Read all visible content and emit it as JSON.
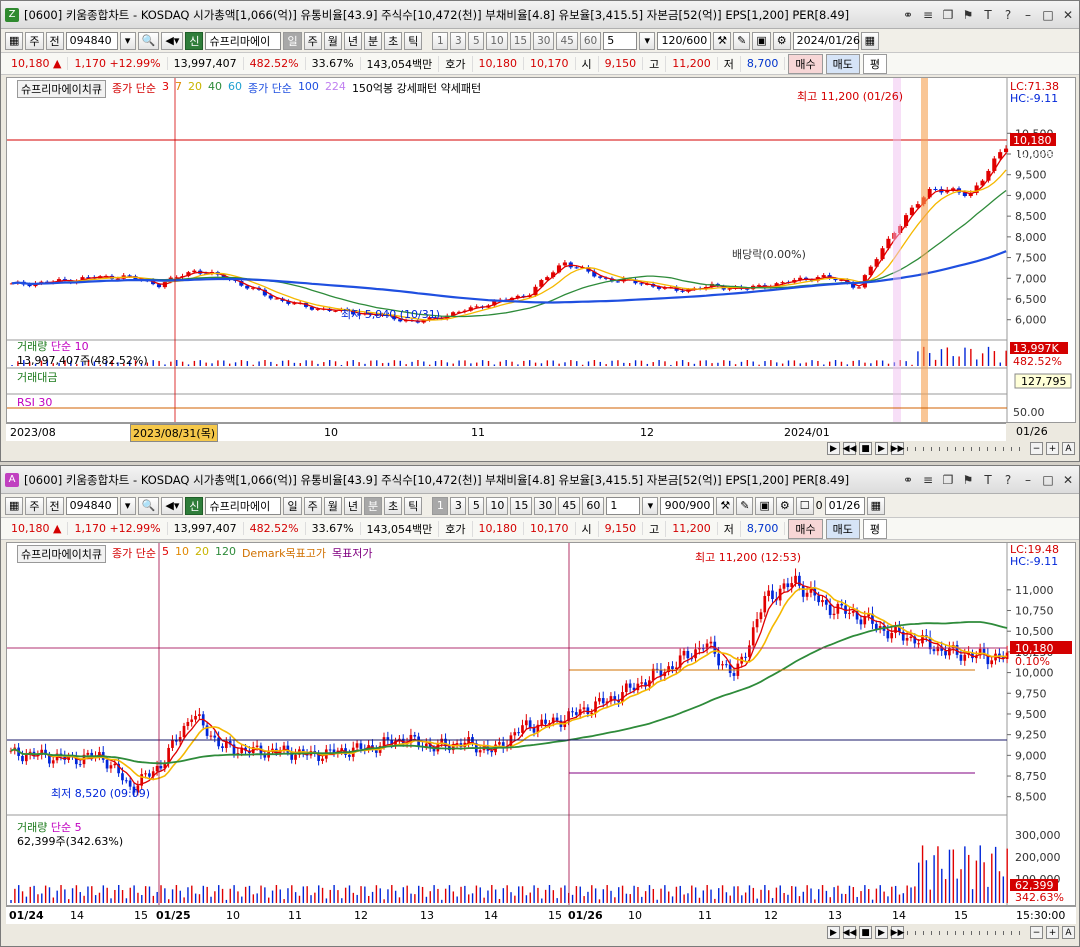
{
  "window_a": {
    "badge": "Z",
    "title": "[0600] 키움종합차트 - KOSDAQ 시가총액[1,066(억)] 유통비율[43.9] 주식수[10,472(천)] 부채비율[4.8] 유보율[3,415.5] 자본금[52(억)] EPS[1,200] PER[8.49]",
    "toolbar": {
      "period": "주",
      "prev": "전",
      "code": "094840",
      "stock_name": "슈프리마에이",
      "intervals": [
        "일",
        "주",
        "월",
        "년",
        "분",
        "초",
        "틱"
      ],
      "active_interval": "일",
      "numbers": [
        "1",
        "3",
        "5",
        "10",
        "15",
        "30",
        "45",
        "60"
      ],
      "unit": "5",
      "count": "120/600",
      "date": "2024/01/26"
    },
    "quote": {
      "price": "10,180",
      "change": "1,170",
      "change_pct": "+12.99%",
      "volume": "13,997,407",
      "volume_pct": "482.52%",
      "turnover": "33.67%",
      "amount": "143,054백만",
      "ask_label": "호가",
      "ask1": "10,180",
      "ask2": "10,170",
      "open_label": "시",
      "open": "9,150",
      "high_label": "고",
      "high": "11,200",
      "low_label": "저",
      "low": "8,700",
      "buy": "매수",
      "sell": "매도",
      "avg": "평"
    },
    "legend": {
      "name": "슈프리마에이치큐",
      "ma_label": "종가 단순",
      "ma_periods": [
        "3",
        "7",
        "20",
        "40",
        "60"
      ],
      "ma2_label": "종가 단순",
      "ma2_periods": [
        "100",
        "224"
      ],
      "extra": "150억봉 강세패턴 약세패턴"
    },
    "annotations": {
      "high": "최고 11,200 (01/26)",
      "low": "최저 5,940 (10/31)",
      "dividend": "배당락(0.00%)"
    },
    "price_axis": [
      "10,500",
      "10,000",
      "9,500",
      "9,000",
      "8,500",
      "8,000",
      "7,500",
      "7,000",
      "6,500",
      "6,000"
    ],
    "price_labels": {
      "lc": "LC:71.38",
      "hc": "HC:-9.11",
      "current": "10,180",
      "pct": "12.99%"
    },
    "volume": {
      "label": "거래량",
      "ma": "단순 10",
      "value": "13,997,407주(482.52%)",
      "badge": "13,997K",
      "pct": "482.52%"
    },
    "big_trade": {
      "label": "거래대금",
      "value": "127,795"
    },
    "rsi": {
      "label": "RSI 30",
      "axis": "50.00"
    },
    "x_axis": [
      "2023/08",
      "2023/08/31(목)",
      "10",
      "11",
      "12",
      "2024/01",
      "01/26"
    ]
  },
  "window_b": {
    "badge": "A",
    "title": "[0600] 키움종합차트 - KOSDAQ 시가총액[1,066(억)] 유통비율[43.9] 주식수[10,472(천)] 부채비율[4.8] 유보율[3,415.5] 자본금[52(억)] EPS[1,200] PER[8.49]",
    "toolbar": {
      "period": "주",
      "prev": "전",
      "code": "094840",
      "stock_name": "슈프리마에이",
      "intervals": [
        "일",
        "주",
        "월",
        "년",
        "분",
        "초",
        "틱"
      ],
      "active_interval": "분",
      "numbers": [
        "1",
        "3",
        "5",
        "10",
        "15",
        "30",
        "45",
        "60"
      ],
      "unit": "1",
      "count": "900/900",
      "check_label": "0",
      "date": "01/26"
    },
    "quote": {
      "price": "10,180",
      "change": "1,170",
      "change_pct": "+12.99%",
      "volume": "13,997,407",
      "volume_pct": "482.52%",
      "turnover": "33.67%",
      "amount": "143,054백만",
      "ask_label": "호가",
      "ask1": "10,180",
      "ask2": "10,170",
      "open_label": "시",
      "open": "9,150",
      "high_label": "고",
      "high": "11,200",
      "low_label": "저",
      "low": "8,700",
      "buy": "매수",
      "sell": "매도",
      "avg": "평"
    },
    "legend": {
      "name": "슈프리마에이치큐",
      "ma_label": "종가 단순",
      "ma_periods": [
        "5",
        "10",
        "20",
        "120"
      ],
      "demark_high": "Demark목표고가",
      "demark_low": "목표저가"
    },
    "annotations": {
      "high": "최고 11,200 (12:53)",
      "low": "최저 8,520 (09:09)"
    },
    "price_axis": [
      "11,000",
      "10,750",
      "10,500",
      "10,250",
      "10,000",
      "9,750",
      "9,500",
      "9,250",
      "9,000",
      "8,750",
      "8,500"
    ],
    "price_labels": {
      "lc": "LC:19.48",
      "hc": "HC:-9.11",
      "current": "10,180",
      "pct": "0.10%"
    },
    "volume": {
      "label": "거래량",
      "ma": "단순 5",
      "value": "62,399주(342.63%)",
      "badge": "62,399",
      "pct": "342.63%",
      "axis": [
        "300,000",
        "200,000",
        "100,000"
      ]
    },
    "x_axis": [
      "01/24",
      "14",
      "15",
      "01/25",
      "10",
      "11",
      "12",
      "13",
      "14",
      "15",
      "01/26",
      "10",
      "11",
      "12",
      "13",
      "14",
      "15",
      "15:30:00"
    ]
  },
  "colors": {
    "up": "#e00000",
    "down": "#0026d9",
    "ma_yellow": "#f5b800",
    "ma_green": "#2e8b3a",
    "ma_blue": "#1f4fe0",
    "ma_purple": "#c080f0"
  },
  "chart_data": [
    {
      "type": "candlestick",
      "title": "슈프리마에이치큐 일봉",
      "x": [
        "2023/08",
        "10",
        "11",
        "12",
        "2024/01",
        "01/26"
      ],
      "ylim": [
        5800,
        11400
      ],
      "close": [
        6850,
        6900,
        7000,
        7050,
        6850,
        7200,
        6950,
        6550,
        6300,
        6200,
        6100,
        5940,
        6150,
        6400,
        6600,
        7400,
        7000,
        6900,
        6700,
        6800,
        6750,
        6900,
        7050,
        6800,
        8200,
        9200,
        9000,
        10180
      ],
      "series": [
        {
          "name": "거래량",
          "last": 13997407
        },
        {
          "name": "RSI 30",
          "last": 50
        }
      ]
    },
    {
      "type": "candlestick",
      "title": "슈프리마에이치큐 1분봉",
      "x": [
        "01/24",
        "01/25",
        "01/26",
        "15:30:00"
      ],
      "ylim": [
        8400,
        11300
      ],
      "close": [
        9020,
        9000,
        8950,
        9000,
        8600,
        8900,
        9500,
        9100,
        9050,
        9050,
        9000,
        9050,
        9100,
        9200,
        9100,
        9150,
        9050,
        9350,
        9400,
        9550,
        9700,
        9900,
        10100,
        10350,
        9950,
        10900,
        11100,
        10800,
        10700,
        10500,
        10400,
        10250,
        10200,
        10180
      ],
      "series": [
        {
          "name": "거래량",
          "last": 62399
        }
      ]
    }
  ]
}
